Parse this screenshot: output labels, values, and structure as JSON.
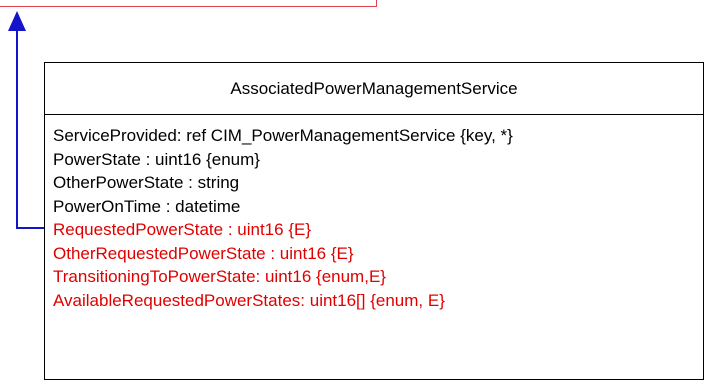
{
  "colors": {
    "line": "#000000",
    "connector": "#1414c8",
    "highlight": "#e00000",
    "top_edge": "#e0414f"
  },
  "class": {
    "name": "AssociatedPowerManagementService",
    "properties": [
      {
        "text": "ServiceProvided: ref CIM_PowerManagementService {key, *}",
        "color": "#000000"
      },
      {
        "text": "PowerState : uint16 {enum}",
        "color": "#000000"
      },
      {
        "text": "OtherPowerState : string",
        "color": "#000000"
      },
      {
        "text": "PowerOnTime : datetime",
        "color": "#000000"
      },
      {
        "text": "RequestedPowerState : uint16 {E}",
        "color": "#e00000"
      },
      {
        "text": "OtherRequestedPowerState : uint16 {E}",
        "color": "#e00000"
      },
      {
        "text": "TransitioningToPowerState: uint16 {enum,E}",
        "color": "#e00000"
      },
      {
        "text": "AvailableRequestedPowerStates: uint16[] {enum, E}",
        "color": "#e00000"
      }
    ]
  }
}
